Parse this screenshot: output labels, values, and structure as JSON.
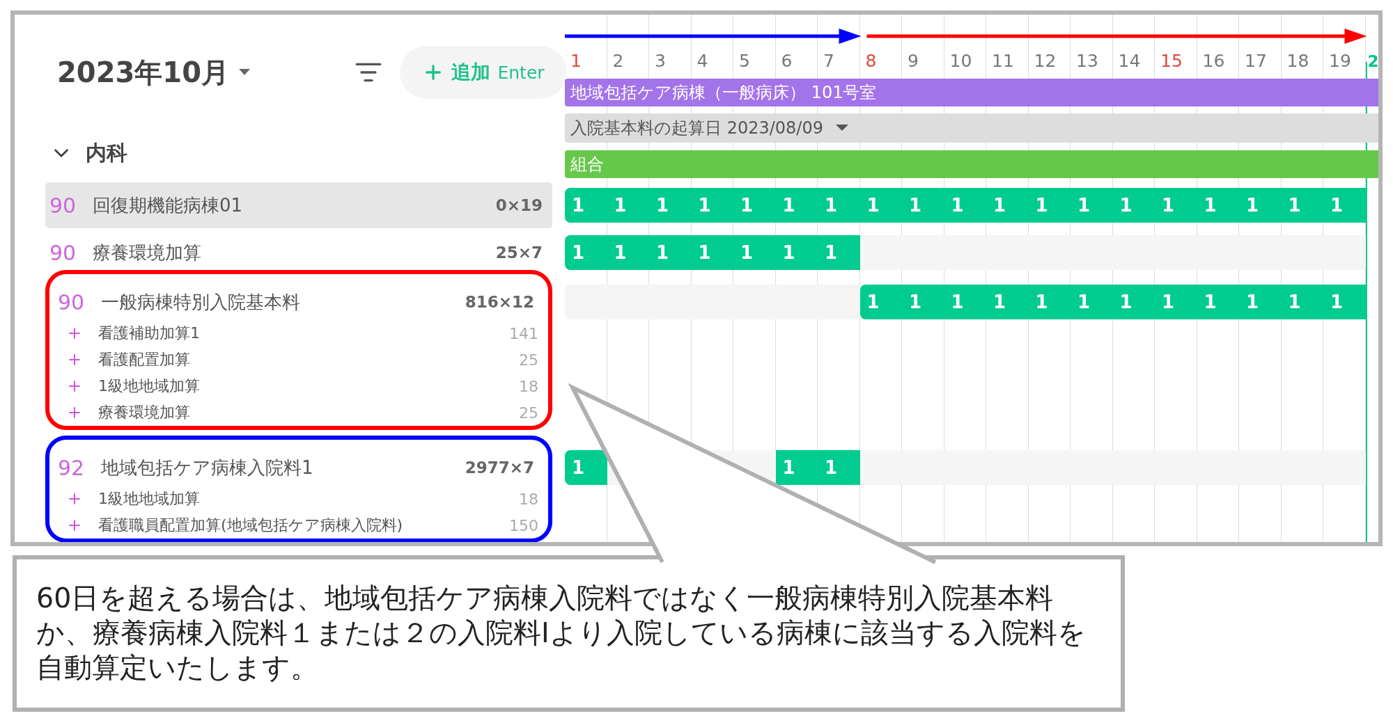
{
  "header": {
    "month": "2023年10月",
    "add_button": {
      "label": "追加",
      "shortcut": "Enter"
    }
  },
  "groups": [
    {
      "label": "内科",
      "expanded": true,
      "items": [
        {
          "code": "90",
          "name": "回復期機能病棟01",
          "amount": "0×19",
          "selected": true,
          "cells": [
            "1",
            "1",
            "1",
            "1",
            "1",
            "1",
            "1",
            "1",
            "1",
            "1",
            "1",
            "1",
            "1",
            "1",
            "1",
            "1",
            "1",
            "1",
            "1"
          ]
        },
        {
          "code": "90",
          "name": "療養環境加算",
          "amount": "25×7",
          "selected": false,
          "cells": [
            "1",
            "1",
            "1",
            "1",
            "1",
            "1",
            "1",
            null,
            null,
            null,
            null,
            null,
            null,
            null,
            null,
            null,
            null,
            null,
            null
          ]
        },
        {
          "code": "90",
          "name": "一般病棟特別入院基本料",
          "amount": "816×12",
          "selected": false,
          "color": "#ff0000",
          "cells": [
            null,
            null,
            null,
            null,
            null,
            null,
            null,
            "1",
            "1",
            "1",
            "1",
            "1",
            "1",
            "1",
            "1",
            "1",
            "1",
            "1",
            "1"
          ],
          "addons": [
            {
              "name": "看護補助加算1",
              "points": "141"
            },
            {
              "name": "看護配置加算",
              "points": "25"
            },
            {
              "name": "1級地地域加算",
              "points": "18"
            },
            {
              "name": "療養環境加算",
              "points": "25"
            }
          ]
        },
        {
          "code": "92",
          "name": "地域包括ケア病棟入院料1",
          "amount": "2977×7",
          "selected": false,
          "color": "#0000ff",
          "cells": [
            "1",
            null,
            null,
            null,
            null,
            "1",
            "1",
            null,
            null,
            null,
            null,
            null,
            null,
            null,
            null,
            null,
            null,
            null,
            null
          ],
          "addons": [
            {
              "name": "1級地地域加算",
              "points": "18"
            },
            {
              "name": "看護職員配置加算(地域包括ケア病棟入院料)",
              "points": "150"
            }
          ]
        }
      ]
    }
  ],
  "timeline": {
    "arrows": [
      {
        "color": "#0000ff"
      },
      {
        "color": "#ff0000"
      }
    ],
    "days": [
      {
        "label": "1",
        "color": "#e0483c"
      },
      {
        "label": "2",
        "color": "#777777"
      },
      {
        "label": "3",
        "color": "#777777"
      },
      {
        "label": "4",
        "color": "#777777"
      },
      {
        "label": "5",
        "color": "#777777"
      },
      {
        "label": "6",
        "color": "#777777"
      },
      {
        "label": "7",
        "color": "#777777"
      },
      {
        "label": "8",
        "color": "#e0483c"
      },
      {
        "label": "9",
        "color": "#777777"
      },
      {
        "label": "10",
        "color": "#777777"
      },
      {
        "label": "11",
        "color": "#777777"
      },
      {
        "label": "12",
        "color": "#777777"
      },
      {
        "label": "13",
        "color": "#777777"
      },
      {
        "label": "14",
        "color": "#777777"
      },
      {
        "label": "15",
        "color": "#e0483c"
      },
      {
        "label": "16",
        "color": "#777777"
      },
      {
        "label": "17",
        "color": "#777777"
      },
      {
        "label": "18",
        "color": "#777777"
      },
      {
        "label": "19",
        "color": "#777777"
      },
      {
        "label": "2",
        "color": "#00c48c"
      }
    ],
    "ward_bar": "地域包括ケア病棟（一般病床） 101号室",
    "start_date_bar": "入院基本料の起算日 2023/08/09",
    "combo_bar": "組合"
  },
  "callout": "60日を超える場合は、地域包括ケア病棟入院料ではなく一般病棟特別入院基本料か、療養病棟入院料１または２の入院料Ⅰより入院している病棟に該当する入院料を自動算定いたします。"
}
